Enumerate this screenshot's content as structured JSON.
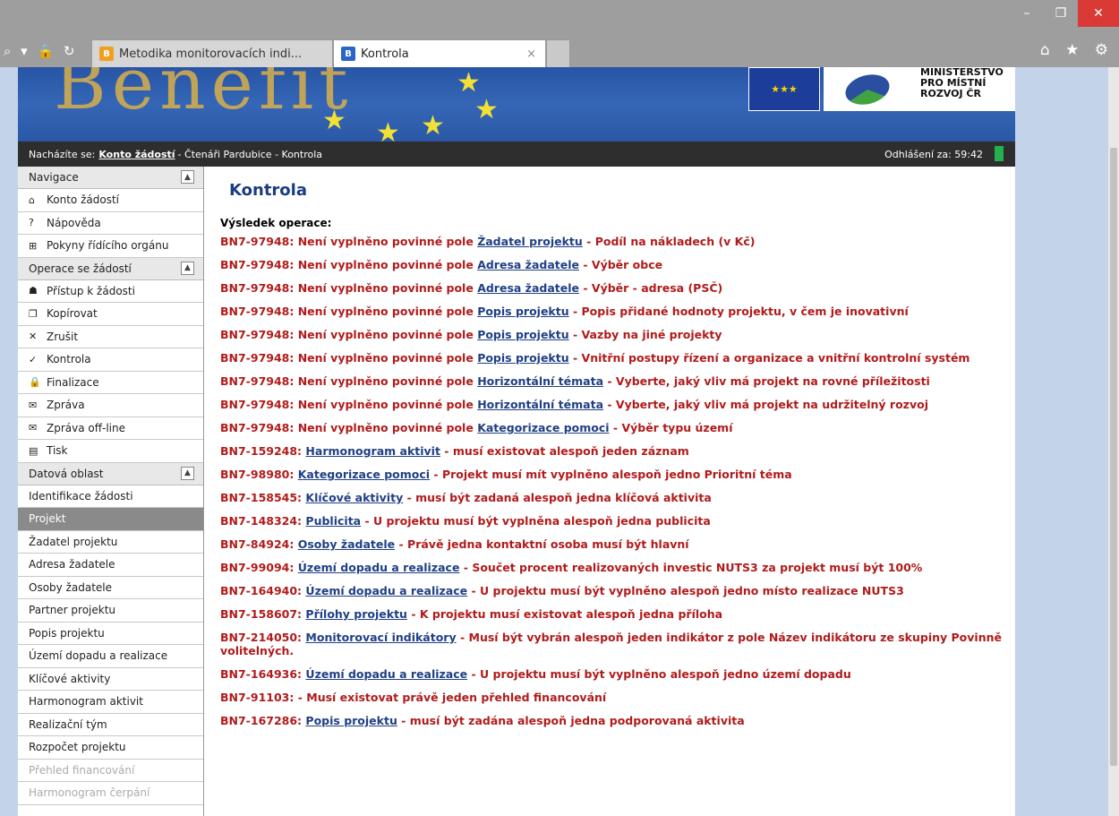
{
  "browser": {
    "window_buttons": [
      "–",
      "❐",
      "✕"
    ],
    "addr_icons": "⌕ ▾ 🔒 ↻",
    "tabs": [
      {
        "label": "Metodika monitorovacích indi...",
        "icon": "B"
      },
      {
        "label": "Kontrola",
        "icon": "B"
      }
    ],
    "tab_close": "×",
    "nav_icons": "⌂ ★ ⚙"
  },
  "banner": {
    "text": "Benefit",
    "stars": [
      "★",
      "★",
      "★",
      "★",
      "★"
    ],
    "eu_flag": "★★★",
    "ministry": "MINISTERSTVO\nPRO MÍSTNÍ\nROZVOJ ČR"
  },
  "breadcrumb": {
    "label": "Nacházíte se:",
    "link": "Konto žádostí",
    "rest": "- Čtenáři Pardubice - Kontrola",
    "logout": "Odhlášení za: 59:42"
  },
  "sidebar": {
    "nav_title": "Navigace",
    "nav_items": [
      {
        "icon": "⌂",
        "label": "Konto žádostí"
      },
      {
        "icon": "?",
        "label": "Nápověda"
      },
      {
        "icon": "⊞",
        "label": "Pokyny řídícího orgánu"
      }
    ],
    "ops_title": "Operace se žádostí",
    "ops_items": [
      {
        "icon": "☗",
        "label": "Přístup k žádosti"
      },
      {
        "icon": "❐",
        "label": "Kopírovat"
      },
      {
        "icon": "✕",
        "label": "Zrušit"
      },
      {
        "icon": "✓",
        "label": "Kontrola"
      },
      {
        "icon": "🔒",
        "label": "Finalizace"
      },
      {
        "icon": "✉",
        "label": "Zpráva"
      },
      {
        "icon": "✉",
        "label": "Zpráva off-line"
      },
      {
        "icon": "▤",
        "label": "Tisk"
      }
    ],
    "data_title": "Datová oblast",
    "data_items": [
      {
        "label": "Identifikace žádosti",
        "state": "normal"
      },
      {
        "label": "Projekt",
        "state": "selected"
      },
      {
        "label": "Žadatel projektu",
        "state": "normal"
      },
      {
        "label": "Adresa žadatele",
        "state": "normal"
      },
      {
        "label": "Osoby žadatele",
        "state": "normal"
      },
      {
        "label": "Partner projektu",
        "state": "normal"
      },
      {
        "label": "Popis projektu",
        "state": "normal"
      },
      {
        "label": "Území dopadu a realizace",
        "state": "normal"
      },
      {
        "label": "Klíčové aktivity",
        "state": "normal"
      },
      {
        "label": "Harmonogram aktivit",
        "state": "normal"
      },
      {
        "label": "Realizační tým",
        "state": "normal"
      },
      {
        "label": "Rozpočet projektu",
        "state": "normal"
      },
      {
        "label": "Přehled financování",
        "state": "disabled"
      },
      {
        "label": "Harmonogram čerpání",
        "state": "disabled"
      }
    ]
  },
  "main": {
    "title": "Kontrola",
    "result_label": "Výsledek operace:",
    "errors": [
      {
        "pre": "BN7-97948: Není vyplněno povinné pole ",
        "link": "Žadatel projektu",
        "post": " - Podíl na nákladech (v Kč)"
      },
      {
        "pre": "BN7-97948: Není vyplněno povinné pole ",
        "link": "Adresa žadatele",
        "post": " - Výběr obce"
      },
      {
        "pre": "BN7-97948: Není vyplněno povinné pole ",
        "link": "Adresa žadatele",
        "post": " - Výběr - adresa (PSČ)"
      },
      {
        "pre": "BN7-97948: Není vyplněno povinné pole ",
        "link": "Popis projektu",
        "post": " - Popis přidané hodnoty projektu, v čem je inovativní"
      },
      {
        "pre": "BN7-97948: Není vyplněno povinné pole ",
        "link": "Popis projektu",
        "post": " - Vazby na jiné projekty"
      },
      {
        "pre": "BN7-97948: Není vyplněno povinné pole ",
        "link": "Popis projektu",
        "post": " - Vnitřní postupy řízení a organizace a vnitřní kontrolní systém"
      },
      {
        "pre": "BN7-97948: Není vyplněno povinné pole ",
        "link": "Horizontální témata",
        "post": " - Vyberte, jaký vliv má projekt na rovné příležitosti"
      },
      {
        "pre": "BN7-97948: Není vyplněno povinné pole ",
        "link": "Horizontální témata",
        "post": " - Vyberte, jaký vliv má projekt na udržitelný rozvoj"
      },
      {
        "pre": "BN7-97948: Není vyplněno povinné pole ",
        "link": "Kategorizace pomoci",
        "post": " - Výběr typu území"
      },
      {
        "pre": "BN7-159248: ",
        "link": "Harmonogram aktivit",
        "post": " - musí existovat alespoň jeden záznam"
      },
      {
        "pre": "BN7-98980: ",
        "link": "Kategorizace pomoci",
        "post": " - Projekt musí mít vyplněno alespoň jedno Prioritní téma"
      },
      {
        "pre": "BN7-158545: ",
        "link": "Klíčové aktivity",
        "post": " - musí být zadaná alespoň jedna klíčová aktivita"
      },
      {
        "pre": "BN7-148324: ",
        "link": "Publicita",
        "post": " - U projektu musí být vyplněna alespoň jedna publicita"
      },
      {
        "pre": "BN7-84924: ",
        "link": "Osoby žadatele",
        "post": " - Právě jedna kontaktní osoba musí být hlavní"
      },
      {
        "pre": "BN7-99094: ",
        "link": "Území dopadu a realizace",
        "post": " - Součet procent realizovaných investic NUTS3 za projekt musí být 100%"
      },
      {
        "pre": "BN7-164940: ",
        "link": "Území dopadu a realizace",
        "post": " - U projektu musí být vyplněno alespoň jedno místo realizace NUTS3"
      },
      {
        "pre": "BN7-158607: ",
        "link": "Přílohy projektu",
        "post": " - K projektu musí existovat alespoň jedna příloha"
      },
      {
        "pre": "BN7-214050: ",
        "link": "Monitorovací indikátory",
        "post": " - Musí být vybrán alespoň jeden indikátor z pole Název indikátoru ze skupiny Povinně volitelných."
      },
      {
        "pre": "BN7-164936: ",
        "link": "Území dopadu a realizace",
        "post": " - U projektu musí být vyplněno alespoň jedno území dopadu"
      },
      {
        "pre": "BN7-91103: - Musí existovat právě jeden přehled financování",
        "link": "",
        "post": ""
      },
      {
        "pre": "BN7-167286: ",
        "link": "Popis projektu",
        "post": " - musí být zadána alespoň jedna podporovaná aktivita"
      }
    ]
  }
}
